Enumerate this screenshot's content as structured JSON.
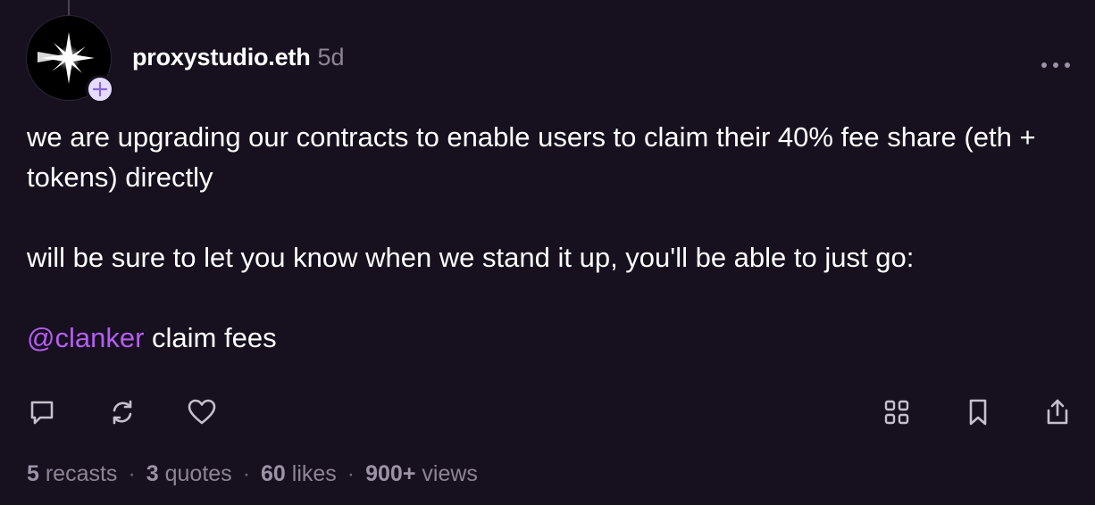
{
  "author": {
    "username": "proxystudio.eth",
    "time_ago": "5d",
    "avatar_icon": "sparkle-star-icon",
    "follow_icon": "plus-icon"
  },
  "post": {
    "paragraph_1": "we are upgrading our contracts to enable users to claim their 40% fee share (eth + tokens) directly",
    "paragraph_2": "will be sure to let you know when we stand it up, you'll be able to just go:",
    "mention": "@clanker",
    "mention_rest": " claim fees"
  },
  "actions": {
    "left": [
      "comment-icon",
      "recast-icon",
      "like-heart-icon"
    ],
    "right": [
      "grid-icon",
      "bookmark-icon",
      "share-icon"
    ]
  },
  "stats": {
    "recasts_count": "5",
    "recasts_label": " recasts",
    "quotes_count": "3",
    "quotes_label": " quotes",
    "likes_count": "60",
    "likes_label": " likes",
    "views_count": "900+",
    "views_label": " views",
    "separator": "·"
  },
  "colors": {
    "background": "#17101f",
    "mention": "#b45ef0",
    "muted_text": "#8d8596",
    "badge": "#e6dcff"
  }
}
